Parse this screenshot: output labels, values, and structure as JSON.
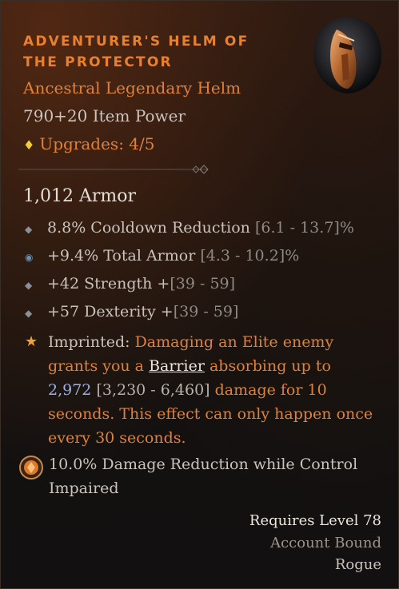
{
  "item": {
    "name": "Adventurer's Helm of the Protector",
    "rarity_type": "Ancestral Legendary Helm",
    "item_power": "790+20 Item Power",
    "upgrades": "Upgrades: 4/5",
    "armor": "1,012 Armor"
  },
  "affixes": [
    {
      "value": "8.8% Cooldown Reduction",
      "range": "[6.1 - 13.7]%",
      "icon": "diamond-bullet-icon"
    },
    {
      "value": "+9.4% Total Armor",
      "range": "[4.3 - 10.2]%",
      "icon": "ring-bullet-icon"
    },
    {
      "value": "+42 Strength +",
      "range": "[39 - 59]",
      "icon": "diamond-bullet-icon"
    },
    {
      "value": "+57 Dexterity +",
      "range": "[39 - 59]",
      "icon": "diamond-bullet-icon"
    }
  ],
  "imprinted": {
    "label": "Imprinted: ",
    "part1": "Damaging an Elite enemy grants you a ",
    "keyword": "Barrier",
    "part2": " absorbing up to ",
    "value": "2,972",
    "range": "[3,230 - 6,460]",
    "part3": " damage for 10 seconds. This effect can only happen once every 30 seconds."
  },
  "aspect_bonus": "10.0% Damage Reduction while Control Impaired",
  "requirements": {
    "level": "Requires Level 78",
    "binding": "Account Bound",
    "class": "Rogue"
  },
  "colors": {
    "legendary": "#e0813a",
    "upgrade_diamond": "#f2cc3a",
    "rolled_value": "#9db0e8",
    "range_text": "#8f8a84"
  }
}
